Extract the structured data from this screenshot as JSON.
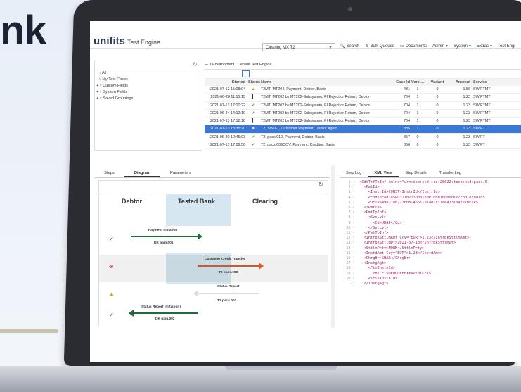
{
  "hero": {
    "partial_word": "nk"
  },
  "app": {
    "logo": "unifits",
    "product": "Test Engine",
    "environment_select": "Clearing MX T2",
    "toolbar": [
      "Search",
      "Bulk Queues",
      "Documents",
      "Admin",
      "System",
      "Extras",
      "Test Engi"
    ]
  },
  "tree": {
    "items": [
      "All",
      "My Test Cases",
      "Custom Fields",
      "System Fields",
      "Saved Groupings"
    ]
  },
  "table": {
    "environment_label": "Environment : Default Test Engine",
    "headers": [
      "Started",
      "Status",
      "Name",
      "Case Id",
      "Versi...",
      "Variant",
      "Amount",
      "Service"
    ],
    "rows": [
      {
        "started": "2021-07-12 15:08:04",
        "status": "warn",
        "name": "T2MT, MT204, Payment, Debtor, Basis",
        "case": "431",
        "ver": "1",
        "var": "0",
        "amount": "1.56",
        "service": "SWIFTMT"
      },
      {
        "started": "2021-06-28 11:15:15",
        "status": "bar",
        "name": "T2MT, MT202 by MT202-Subsystem, FI Reject or Return, Debtor",
        "case": "704",
        "ver": "1",
        "var": "0",
        "amount": "1.23",
        "service": "SWIFTMT"
      },
      {
        "started": "2021-07-13 17:10:22",
        "status": "ok",
        "name": "T2MT, MT202 by MT202-Subsystem, FI Reject or Return, Debtor",
        "case": "704",
        "ver": "1",
        "var": "0",
        "amount": "1.23",
        "service": "SWIFTMT"
      },
      {
        "started": "2021-06-24 14:12:19",
        "status": "ok",
        "name": "T2MT, MT202 by MT202-Subsystem, FI Reject or Return, Debtor",
        "case": "704",
        "ver": "1",
        "var": "0",
        "amount": "1.23",
        "service": "SWIFTMT"
      },
      {
        "started": "2021-07-13 17:12:18",
        "status": "bar",
        "name": "T2MT, MT202 by MT202-Subsystem, FI Reject or Return, Debtor",
        "case": "704",
        "ver": "1",
        "var": "0",
        "amount": "1.23",
        "service": "SWIFTMT"
      },
      {
        "started": "2021-07-13 13:35:20",
        "status": "err",
        "name": "T2, SWIFT, Customer Payment, Debtor Agent",
        "case": "885",
        "ver": "1",
        "var": "0",
        "amount": "1.23",
        "service": "SWIFT",
        "selected": true
      },
      {
        "started": "2021-06-30 12:45:03",
        "status": "ok",
        "name": "T2, pacs.010, Payment, Debtor, Basis",
        "case": "857",
        "ver": "0",
        "var": "0",
        "amount": "1.23",
        "service": "SWIFT"
      },
      {
        "started": "2021-07-13 17:09:56",
        "status": "ok",
        "name": "T2, pacs.009COV, Payment, Creditor, Basis",
        "case": "856",
        "ver": "0",
        "var": "0",
        "amount": "1.23",
        "service": "SWIFT"
      }
    ]
  },
  "left_tabs": [
    "Steps",
    "Diagram",
    "Parameters"
  ],
  "diagram": {
    "columns": [
      "Debtor",
      "Tested Bank",
      "Clearing"
    ],
    "steps": [
      {
        "status": "ok",
        "title": "Payment Initiation",
        "sub": "DK pain.001"
      },
      {
        "status": "err",
        "title": "Customer Credit Transfer",
        "sub": "T2 pacs.008"
      },
      {
        "status": "warn",
        "title": "Status Report",
        "sub": "T2 pacs.002"
      },
      {
        "status": "ok",
        "title": "Status Report (Initiation)",
        "sub": "DK pain.002"
      }
    ]
  },
  "right_tabs": [
    "Step Log",
    "XML View",
    "Step Details",
    "Transfer Log"
  ],
  "xml_lines": [
    "<CdtTrfTxInf xmlns=\"urn:iso:std:iso:20022:tech:xsd:pacs.0",
    "  <PmtId>",
    "    <InstrId>CONST-InstrId</InstrId>",
    "    <EndToEndId>PU3210713000180P10001E00001</EndToEndId>",
    "    <UETR>498218b7-2bb8-4551-b7ad-ff7ee4731baf</UETR>",
    "  </PmtId>",
    "  <PmtTpInf>",
    "    <SvcLvl>",
    "      <Cd>URGP</Cd>",
    "    </SvcLvl>",
    "  </PmtTpInf>",
    "  <IntrBkSttlmAmt Ccy=\"EUR\">1.23</IntrBkSttlmAmt>",
    "  <IntrBkSttlmDt>2021-07-13</IntrBkSttlmDt>",
    "  <SttlmPrty>NORM</SttlmPrty>",
    "  <InstdAmt Ccy=\"EUR\">1.23</InstdAmt>",
    "  <ChrgBr>SHAR</ChrgBr>",
    "  <InstgAgt>",
    "    <FinInstnId>",
    "      <BICFI>DEMODEFFXXX</BICFI>",
    "    </FinInstnId>",
    "  </InstgAgt>"
  ]
}
